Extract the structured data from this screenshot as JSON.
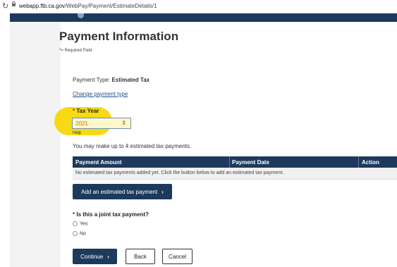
{
  "browser": {
    "reload_icon": "reload-icon",
    "url_host": "webapp.ftb.ca.gov",
    "url_path": "/WebPay/Payment/EstimateDetails/1"
  },
  "page": {
    "title": "Payment Information",
    "required_note": "= Required Field",
    "required_star": "*"
  },
  "payment_type": {
    "label": "Payment Type: ",
    "value": "Estimated Tax",
    "change_link": "Change payment type"
  },
  "tax_year": {
    "label": "Tax Year",
    "selected": "2021",
    "help": "Help"
  },
  "estimated": {
    "info": "You may make up to 4 estimated tax payments.",
    "columns": [
      "Payment Amount",
      "Payment Date",
      "Action"
    ],
    "empty_message": "No estimated tax payments added yet. Click the button below to add an estimated tax payment.",
    "add_button": "Add an estimated tax payment"
  },
  "joint": {
    "label": "Is this a joint tax payment?",
    "options": [
      "Yes",
      "No"
    ]
  },
  "actions": {
    "continue": "Continue",
    "back": "Back",
    "cancel": "Cancel"
  },
  "colors": {
    "navy": "#1d3a5c",
    "link": "#1a4e8a",
    "highlight": "#f5d800",
    "required": "#c00000"
  }
}
